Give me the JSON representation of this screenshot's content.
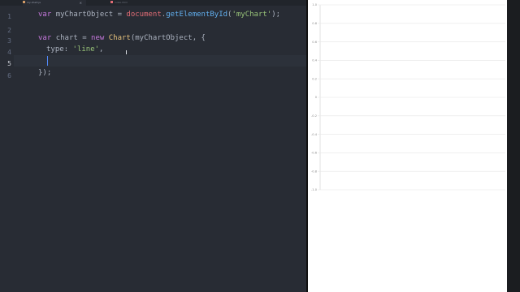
{
  "tabs": [
    {
      "label": "my-chart.js",
      "active": true
    },
    {
      "label": "index.html",
      "active": false
    }
  ],
  "tab_close": "×",
  "gutter": {
    "lines": [
      "1",
      "2",
      "3",
      "4",
      "5",
      "6"
    ],
    "current_line": 5
  },
  "code": {
    "line1": {
      "kw": "var",
      "var": "myChartObject",
      "eq": "=",
      "obj": "document",
      "dot": ".",
      "fn": "getElementById",
      "open": "(",
      "str": "'myChart'",
      "close": ");"
    },
    "line3": {
      "kw": "var",
      "var": "chart",
      "eq": "=",
      "new": "new",
      "cls": "Chart",
      "open": "(",
      "arg": "myChartObject",
      "rest": ", {"
    },
    "line4": {
      "key": "type",
      "colon": ":",
      "str": "'line'",
      "comma": ","
    },
    "line6": {
      "text": "});"
    }
  },
  "colors": {
    "editor_bg": "#282c34",
    "keyword": "#c678dd",
    "variable": "#e06c75",
    "object": "#e5c07b",
    "function": "#61afef",
    "string": "#98c379",
    "gridline": "#e6e6e6"
  },
  "chart_data": {
    "type": "line",
    "series": [],
    "ylim": [
      -1.0,
      1.0
    ],
    "yticks": [
      "1.0",
      "0.8",
      "0.6",
      "0.4",
      "0.2",
      "0",
      "-0.2",
      "-0.4",
      "-0.6",
      "-0.8",
      "-1.0"
    ],
    "grid": true
  }
}
